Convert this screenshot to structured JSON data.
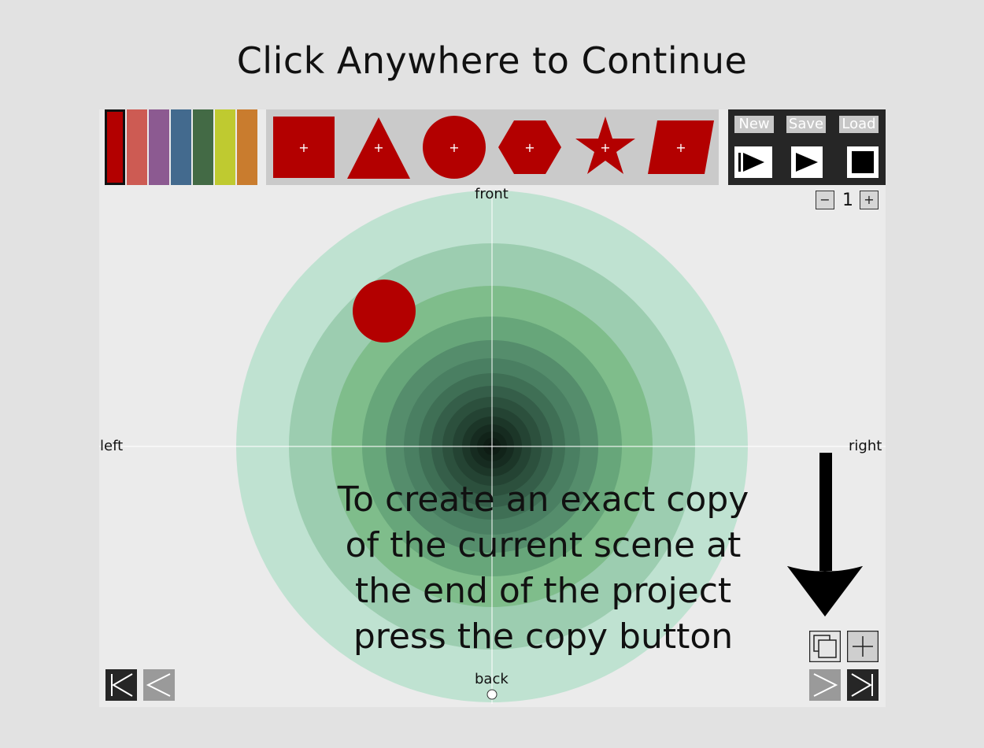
{
  "overlay": {
    "title": "Click Anywhere to Continue"
  },
  "palette": [
    {
      "name": "red",
      "color": "#b30000",
      "selected": true
    },
    {
      "name": "coral",
      "color": "#cd5b53"
    },
    {
      "name": "purple",
      "color": "#8c5a91"
    },
    {
      "name": "blue",
      "color": "#436a8e"
    },
    {
      "name": "green",
      "color": "#436a45"
    },
    {
      "name": "lime",
      "color": "#bfca30"
    },
    {
      "name": "orange",
      "color": "#c97c2e"
    }
  ],
  "shape_tools": [
    "square",
    "triangle",
    "circle",
    "hexagon",
    "star",
    "parallelogram"
  ],
  "shape_color": "#b30000",
  "controls": {
    "new_label": "New",
    "save_label": "Save",
    "load_label": "Load",
    "play_from_start_icon": "play-from-start-icon",
    "play_icon": "play-icon",
    "stop_icon": "stop-icon"
  },
  "scene_stepper": {
    "minus": "−",
    "value": "1",
    "plus": "+"
  },
  "axes": {
    "front": "front",
    "back": "back",
    "left": "left",
    "right": "right"
  },
  "instruction": {
    "lines": [
      "To create an exact copy",
      "of the current scene at",
      "the end of the project",
      "press the copy button"
    ]
  },
  "colors": {
    "ring_light": "#bfe2d1",
    "center": "#0d1a12",
    "background": "#e2e2e2",
    "stage": "#ebebeb"
  }
}
